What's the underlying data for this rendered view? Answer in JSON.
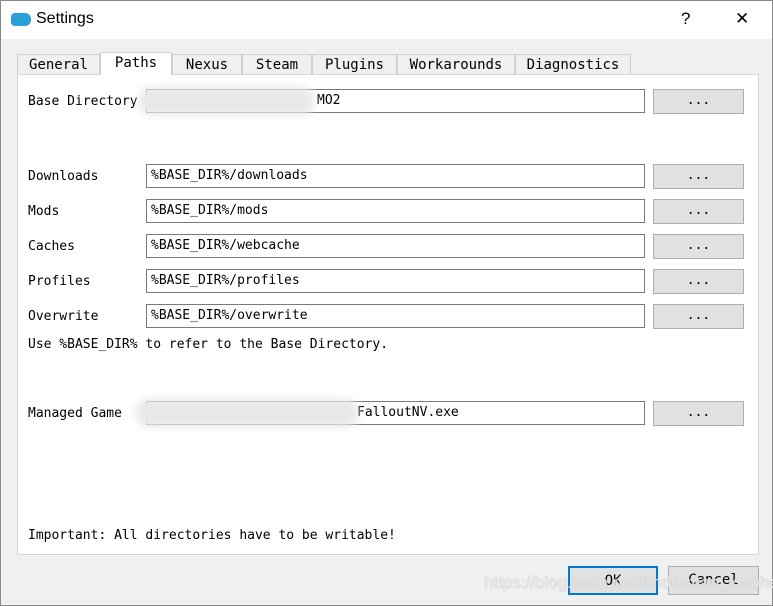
{
  "window": {
    "title": "Settings",
    "help": "?",
    "close": "✕"
  },
  "tabs": [
    "General",
    "Paths",
    "Nexus",
    "Steam",
    "Plugins",
    "Workarounds",
    "Diagnostics"
  ],
  "active_tab": "Paths",
  "base_directory": {
    "label": "Base Directory",
    "value": "MO2",
    "button": "..."
  },
  "paths": [
    {
      "label": "Downloads",
      "value": "%BASE_DIR%/downloads",
      "button": "..."
    },
    {
      "label": "Mods",
      "value": "%BASE_DIR%/mods",
      "button": "..."
    },
    {
      "label": "Caches",
      "value": "%BASE_DIR%/webcache",
      "button": "..."
    },
    {
      "label": "Profiles",
      "value": "%BASE_DIR%/profiles",
      "button": "..."
    },
    {
      "label": "Overwrite",
      "value": "%BASE_DIR%/overwrite",
      "button": "..."
    }
  ],
  "hint": "Use %BASE_DIR% to refer to the Base Directory.",
  "managed_game": {
    "label": "Managed Game",
    "value": "FalloutNV.exe",
    "button": "..."
  },
  "important": "Important: All directories have to be writable!",
  "buttons": {
    "ok": "OK",
    "cancel": "Cancel"
  },
  "watermark": "https://blog.csdn.net/Enderman_xiaohei",
  "colors": {
    "accent": "#0078d7",
    "app_icon": "#2a9fd8"
  }
}
